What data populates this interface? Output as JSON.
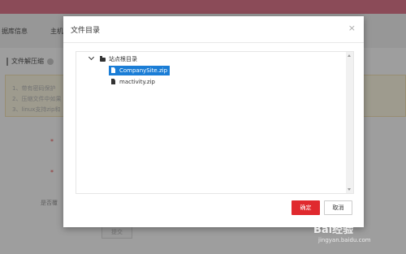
{
  "background": {
    "nav": [
      "据库信息",
      "主机"
    ],
    "page_title": "文件解压缩",
    "tips": [
      "1、带有密码保护",
      "2、压缩文件中如果",
      "3、linux支持zip和"
    ],
    "submit": "提交",
    "label_show": "是否覆"
  },
  "modal": {
    "title": "文件目录",
    "close": "×",
    "tree": {
      "root": "站点根目录",
      "files": [
        "CompanySite.zip",
        "mactivity.zip"
      ],
      "selected_index": 0
    },
    "ok_label": "确定",
    "cancel_label": "取消"
  },
  "watermark": {
    "text": "Bai经验",
    "url": "jingyan.baidu.com"
  },
  "colors": {
    "accent": "#1a7dd6",
    "ok_button": "#e0292e",
    "topbar": "#e07a8e"
  }
}
